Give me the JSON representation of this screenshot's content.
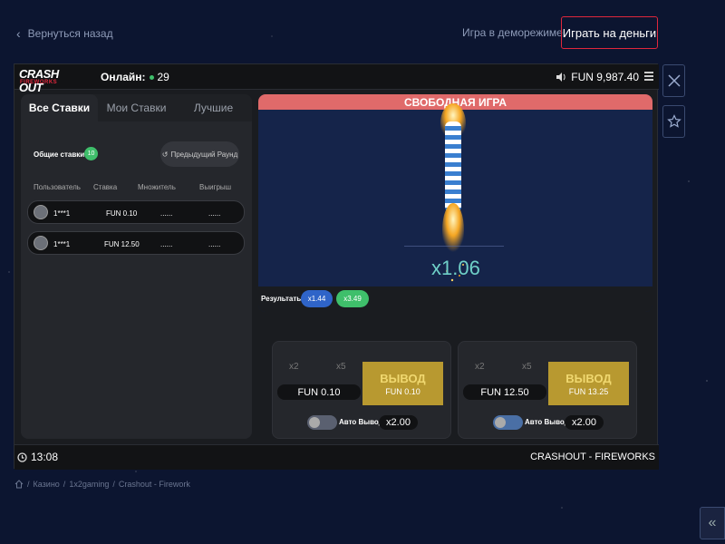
{
  "top": {
    "back_label": "Вернуться назад",
    "demo_label": "Игра в деморежиме",
    "play_money_label": "Играть на деньги"
  },
  "game_header": {
    "logo_text": "CRASH OUT",
    "logo_sub": "FIREWORKS",
    "online_label": "Онлайн:",
    "online_count": "29",
    "balance": "FUN 9,987.40"
  },
  "tabs": [
    {
      "label": "Все Ставки",
      "active": true
    },
    {
      "label": "Мои Ставки",
      "active": false
    },
    {
      "label": "Лучшие",
      "active": false
    }
  ],
  "bets": {
    "total_label": "Общие ставки:",
    "total_count": "10",
    "prev_round_label": "Предыдущий Раунд",
    "columns": [
      "Пользователь",
      "Ставка",
      "Множитель",
      "Выигрыш"
    ],
    "rows": [
      {
        "user": "1***1",
        "stake": "FUN 0.10",
        "mult": "......",
        "win": "......"
      },
      {
        "user": "1***1",
        "stake": "FUN 12.50",
        "mult": "......",
        "win": "......"
      }
    ]
  },
  "stage": {
    "banner": "СВОБОДНАЯ ИГРА",
    "multiplier": "x1.06",
    "results_label": "Результаты:",
    "results": [
      {
        "value": "x1.44",
        "color": "#2f64c8"
      },
      {
        "value": "x3.49",
        "color": "#3fbf6b"
      }
    ]
  },
  "bet_panels": [
    {
      "q1": "x2",
      "q2": "x5",
      "amount": "FUN 0.10",
      "cash_label": "ВЫВОД",
      "cash_value": "FUN 0.10",
      "auto_label": "Авто Вывод",
      "auto_value": "x2.00"
    },
    {
      "q1": "x2",
      "q2": "x5",
      "amount": "FUN 12.50",
      "cash_label": "ВЫВОД",
      "cash_value": "FUN 13.25",
      "auto_label": "Авто Вывод",
      "auto_value": "x2.00"
    }
  ],
  "footer": {
    "time": "13:08",
    "game_name": "CRASHOUT - FIREWORKS"
  },
  "breadcrumb": [
    "Казино",
    "1x2gaming",
    "Crashout - Firework"
  ],
  "colors": {
    "accent_red": "#e0273c",
    "gold": "#b89930",
    "banner": "#e06a6a"
  }
}
